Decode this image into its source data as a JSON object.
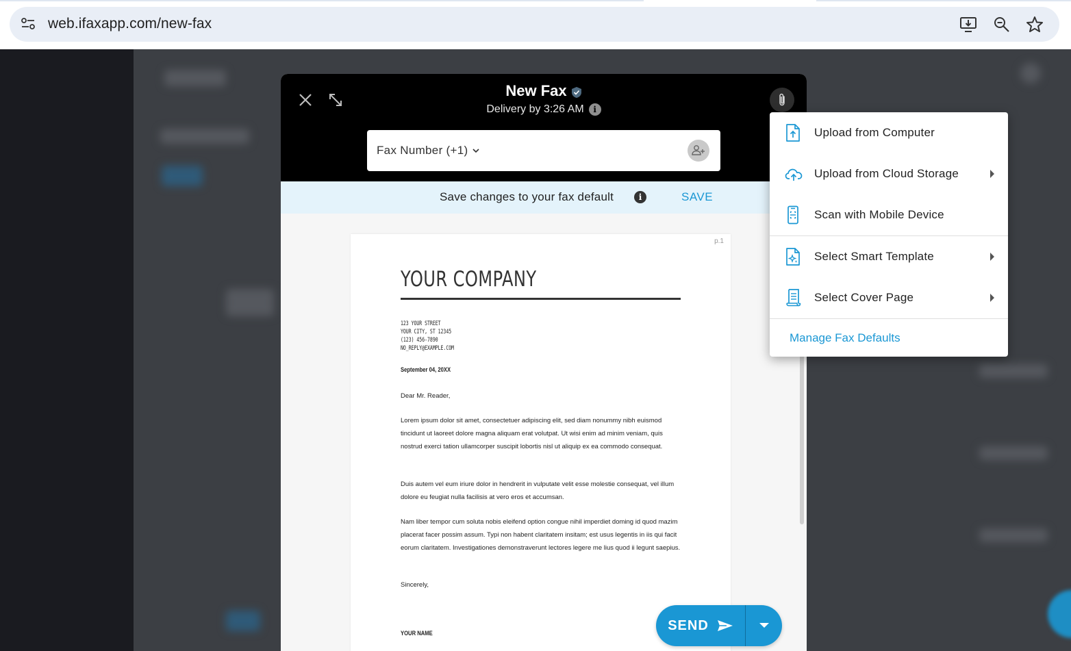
{
  "browser": {
    "url": "web.ifaxapp.com/new-fax",
    "icons": [
      "site-info-icon",
      "install-app-icon",
      "zoom-icon",
      "bookmark-star-icon"
    ]
  },
  "modal": {
    "title": "New Fax",
    "delivery": "Delivery by 3:26 AM",
    "fax_number_label": "Fax Number (+1)",
    "save_bar": {
      "text": "Save changes to your fax default",
      "save_label": "SAVE"
    }
  },
  "document": {
    "page_number": "p.1",
    "company": "YOUR COMPANY",
    "address_lines": [
      "123 YOUR STREET",
      "YOUR CITY, ST 12345",
      "(123) 456-7890",
      "NO_REPLY@EXAMPLE.COM"
    ],
    "date": "September 04, 20XX",
    "salutation": "Dear Mr. Reader,",
    "paragraphs": [
      "Lorem ipsum dolor sit amet, consectetuer adipiscing elit, sed diam nonummy nibh euismod tincidunt ut laoreet dolore magna aliquam erat volutpat. Ut wisi enim ad minim veniam, quis nostrud exerci tation ullamcorper suscipit lobortis nisl ut aliquip ex ea commodo consequat.",
      "Duis autem vel eum iriure dolor in hendrerit in vulputate velit esse molestie consequat, vel illum dolore eu feugiat nulla facilisis at vero eros et accumsan.",
      "Nam liber tempor cum soluta nobis eleifend option congue nihil imperdiet doming id quod mazim placerat facer possim assum. Typi non habent claritatem insitam; est usus legentis in iis qui facit eorum claritatem. Investigationes demonstraverunt lectores legere me lius quod ii legunt saepius."
    ],
    "closing": "Sincerely,",
    "signature": "YOUR NAME"
  },
  "send": {
    "label": "SEND"
  },
  "attach_menu": {
    "items": [
      {
        "label": "Upload from Computer",
        "icon": "file-upload-icon",
        "submenu": false
      },
      {
        "label": "Upload from Cloud Storage",
        "icon": "cloud-upload-icon",
        "submenu": true
      },
      {
        "label": "Scan with Mobile Device",
        "icon": "mobile-scan-icon",
        "submenu": false
      },
      {
        "label": "Select Smart Template",
        "icon": "smart-template-icon",
        "submenu": true
      },
      {
        "label": "Select Cover Page",
        "icon": "cover-page-icon",
        "submenu": true
      }
    ],
    "manage_link": "Manage Fax Defaults"
  },
  "colors": {
    "accent": "#1a97d4",
    "header": "#000000",
    "save_bar": "#e4f3fb"
  }
}
